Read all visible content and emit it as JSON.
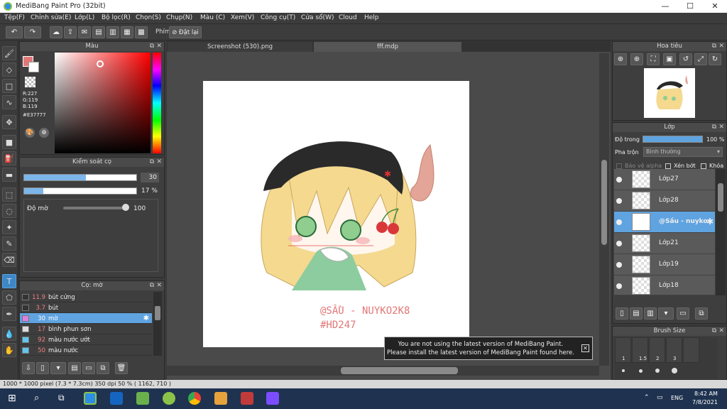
{
  "window": {
    "title": "MediBang Paint Pro (32bit)",
    "minimize": "—",
    "maximize": "☐",
    "close": "✕"
  },
  "menu": [
    "Tệp(F)",
    "Chỉnh sửa(E)",
    "Lớp(L)",
    "Bộ lọc(R)",
    "Chọn(S)",
    "Chụp(N)",
    "Màu (C)",
    "Xem(V)",
    "Công cụ(T)",
    "Cửa sổ(W)",
    "Cloud",
    "Help"
  ],
  "toolbar": {
    "hand_label": "Phím",
    "reset_label": "Đặt lại"
  },
  "color_panel": {
    "title": "Màu",
    "r": "R:227",
    "g": "G:119",
    "b": "B:119",
    "hex": "#E37777",
    "fg_color": "#e37777"
  },
  "brush_control": {
    "title": "Kiểm soát cọ",
    "size_value": "30",
    "opacity_value": "17 %",
    "blur_label": "Độ mờ",
    "blur_value": "100",
    "size_fraction": 0.55,
    "opacity_fraction": 0.17
  },
  "brush_panel": {
    "title": "Cọ: mờ",
    "items": [
      {
        "size": "11.9",
        "name": "bút cứng",
        "color": "#333333"
      },
      {
        "size": "3.7",
        "name": "bút",
        "color": "#333333"
      },
      {
        "size": "30",
        "name": "mờ",
        "color": "#e07fe0"
      },
      {
        "size": "17",
        "name": "bình phun sơn",
        "color": "#dddddd"
      },
      {
        "size": "92",
        "name": "màu nước ướt",
        "color": "#5fc8f0"
      },
      {
        "size": "50",
        "name": "màu nước",
        "color": "#5fc8f0"
      }
    ]
  },
  "tabs": [
    "Screenshot (530).png",
    "fff.mdp"
  ],
  "artwork": {
    "line1": "@SẦU - NUYKO2K8",
    "line2": "#HD247"
  },
  "notice": {
    "line1": "You are not using the latest version of MediBang Paint.",
    "line2": "Please install the latest version of MediBang Paint found here."
  },
  "navigator": {
    "title": "Hoa tiêu"
  },
  "layers_panel": {
    "title": "Lớp",
    "opacity_label": "Độ trong",
    "opacity_value": "100 %",
    "blend_label": "Pha trộn",
    "blend_value": "Bình thường",
    "protect_alpha": "Bảo vệ alpha",
    "clip": "Xén bớt",
    "lock": "Khóa",
    "layers": [
      "Lớp27",
      "Lớp28",
      "@Sầu - nuyko",
      "Lớp21",
      "Lớp19",
      "Lớp18"
    ]
  },
  "brush_size_panel": {
    "title": "Brush Size",
    "sizes": [
      "1",
      "1.5",
      "2",
      "3"
    ]
  },
  "status": {
    "text": "1000 * 1000 pixel   (7.3 * 7.3cm)  350 dpi   50 %   ( 1162, 710 )"
  },
  "taskbar": {
    "lang": "ENG",
    "time": "8:42 AM",
    "date": "7/8/2021"
  }
}
